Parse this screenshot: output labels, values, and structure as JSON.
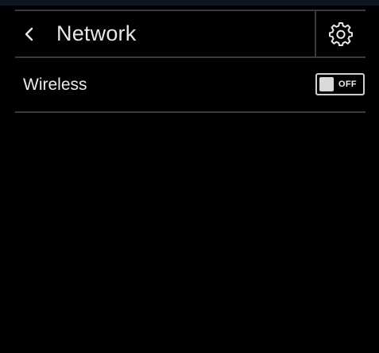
{
  "header": {
    "title": "Network",
    "back_icon": "chevron-left-icon",
    "settings_icon": "gear-icon"
  },
  "settings": {
    "wireless": {
      "label": "Wireless",
      "toggle_state": "OFF",
      "enabled": false
    }
  },
  "colors": {
    "background": "#000000",
    "top_strip": "#0d1620",
    "divider": "#3a3a3a",
    "text": "#e8e8e8"
  }
}
